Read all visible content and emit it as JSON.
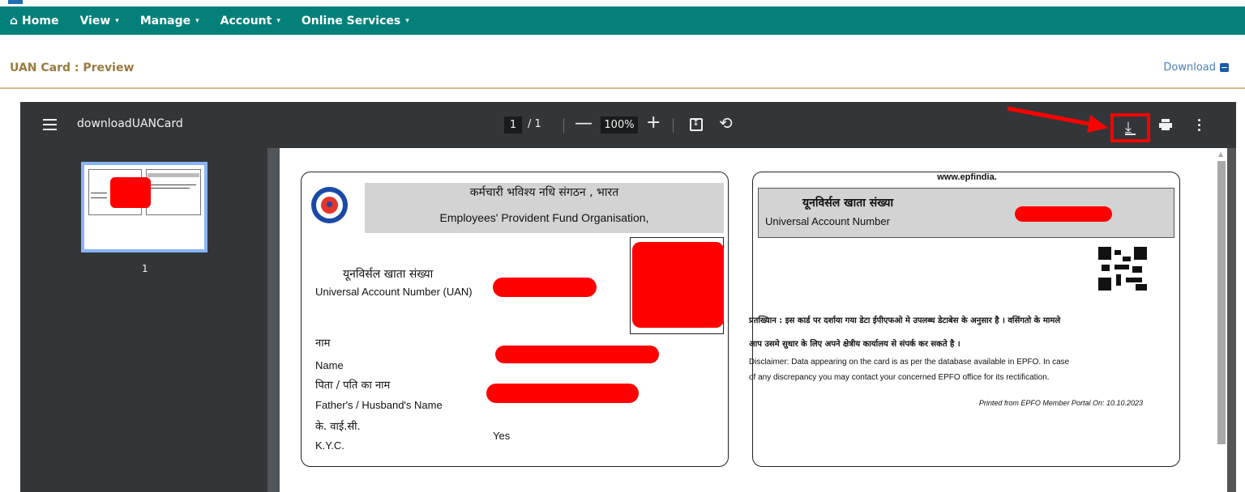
{
  "nav": {
    "items": [
      {
        "label": "Home",
        "icon": "home-icon",
        "caret": ""
      },
      {
        "label": "View",
        "caret": "▾"
      },
      {
        "label": "Manage",
        "caret": "▾"
      },
      {
        "label": "Account",
        "caret": "▾"
      },
      {
        "label": "Online Services",
        "caret": "▾"
      }
    ],
    "home_glyph": "⌂",
    "bg_color": "#03807a"
  },
  "panel": {
    "title": "UAN Card : Preview",
    "download_label": "Download"
  },
  "viewer": {
    "doc_title": "downloadUANCard",
    "current_page": "1",
    "total_pages": "/ 1",
    "zoom": "100%",
    "zoom_out_glyph": "—",
    "zoom_in_glyph": "+",
    "rotate_glyph": "⟲",
    "download_glyph": "⤓",
    "thumbnail_page_number": "1",
    "download_highlight_color": "#ff0000"
  },
  "card_front": {
    "org_hindi": "कर्मचारी भविश्य नधि संगठन , भारत",
    "org_english": "Employees' Provident Fund Organisation,",
    "uan_label_hindi": "यूनविर्सल खाता संख्या",
    "uan_label_english": "Universal Account Number (UAN)",
    "name_label_hindi": "नाम",
    "name_label_english": "Name",
    "father_label_hindi": "पिता / पति का नाम",
    "father_label_english": "Father's / Husband's Name",
    "kyc_label_hindi": "के. वाई.सी.",
    "kyc_label_english": "K.Y.C.",
    "kyc_value": "Yes"
  },
  "card_back": {
    "website": "www.epfindia.",
    "uan_label_hindi": "यूनविर्सल खाता संख्या",
    "uan_label_english": "Universal Account Number",
    "disclaimer_hindi_line1": "प्रतख्यिान :   इस कार्ड पर दर्शाया गया डेटा ईपीएफओ मे उपलब्ध  डेटाबेस के अनुसार है । वसिंगतो के मामले",
    "disclaimer_hindi_line2": "आप उसमे सुधार के लिए अपने क्षेत्रीय  कार्यालय से संपर्क कर सकते है ।",
    "disclaimer_english_line1": "Disclaimer:   Data appearing on the card is as per the  database available in EPFO. In case",
    "disclaimer_english_line2": "of any discrepancy you may contact your concerned EPFO office for its rectification.",
    "printed_note": "Printed from EPFO Member Portal On: 10.10.2023"
  }
}
